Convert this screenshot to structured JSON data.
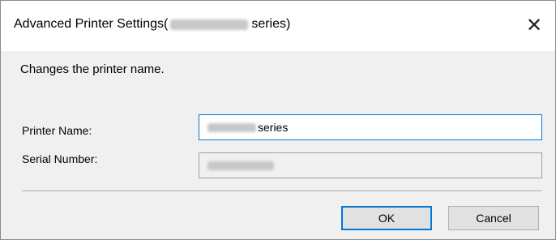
{
  "window": {
    "title_prefix": "Advanced Printer Settings(",
    "title_suffix": "series)",
    "close_glyph": "✕"
  },
  "description": "Changes the printer name.",
  "form": {
    "printer_name_label": "Printer Name:",
    "printer_name_value_suffix": "series",
    "serial_number_label": "Serial Number:"
  },
  "buttons": {
    "ok_label": "OK",
    "cancel_label": "Cancel"
  },
  "colors": {
    "focus_accent": "#0078d7",
    "dialog_background": "#f0f0f0",
    "button_face": "#e1e1e1"
  }
}
